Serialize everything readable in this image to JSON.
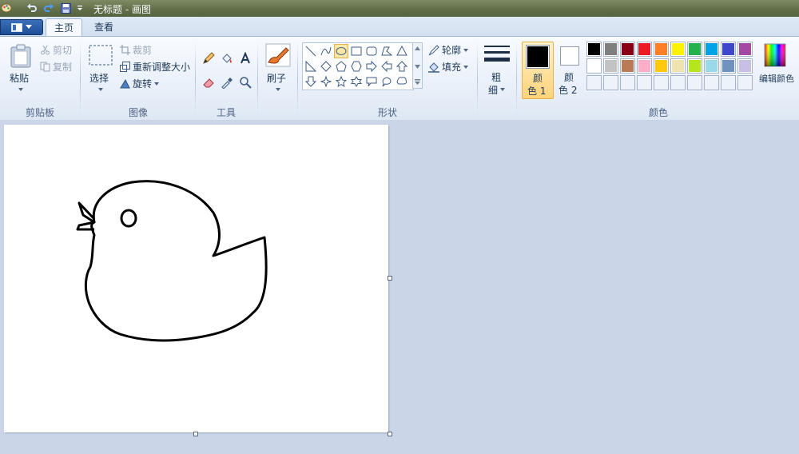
{
  "window": {
    "title": "无标题 - 画图"
  },
  "quick_access": {
    "icons": [
      "paint-logo-icon",
      "undo-icon",
      "redo-icon",
      "save-icon",
      "customize-dropdown-icon"
    ]
  },
  "tabs": [
    {
      "label": "主页",
      "active": true
    },
    {
      "label": "查看",
      "active": false
    }
  ],
  "clipboard": {
    "paste_label": "粘贴",
    "cut_label": "剪切",
    "copy_label": "复制",
    "group_label": "剪贴板"
  },
  "image": {
    "select_label": "选择",
    "crop_label": "裁剪",
    "resize_label": "重新调整大小",
    "rotate_label": "旋转",
    "group_label": "图像"
  },
  "tools": {
    "group_label": "工具",
    "items": [
      "pencil-icon",
      "fill-icon",
      "text-icon",
      "eraser-icon",
      "color-picker-icon",
      "magnifier-icon"
    ]
  },
  "brushes": {
    "label": "刷子"
  },
  "shapes": {
    "group_label": "形状",
    "outline_label": "轮廓",
    "fill_label": "填充",
    "selected": "oval"
  },
  "size": {
    "label_top": "粗",
    "label_bottom": "细"
  },
  "colors": {
    "group_label": "颜色",
    "color1_top": "颜",
    "color1_bottom": "色 1",
    "color2_top": "颜",
    "color2_bottom": "色 2",
    "color1_value": "#000000",
    "color2_value": "#ffffff",
    "edit_label": "编辑颜色",
    "palette": [
      [
        "#000000",
        "#7f7f7f",
        "#880015",
        "#ed1c24",
        "#ff7f27",
        "#fff200",
        "#22b14c",
        "#00a2e8",
        "#3f48cc",
        "#a349a4"
      ],
      [
        "#ffffff",
        "#c3c3c3",
        "#b97a57",
        "#ffaec9",
        "#ffc90e",
        "#efe4b0",
        "#b5e61d",
        "#99d9ea",
        "#7092be",
        "#c8bfe7"
      ],
      [
        "#ffffff",
        "#ffffff",
        "#ffffff",
        "#ffffff",
        "#ffffff",
        "#ffffff",
        "#ffffff",
        "#ffffff",
        "#ffffff",
        "#ffffff"
      ]
    ]
  }
}
